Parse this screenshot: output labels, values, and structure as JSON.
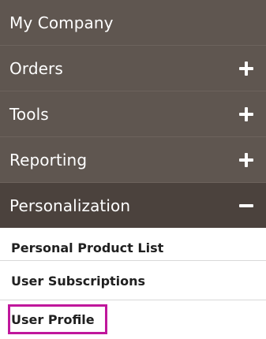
{
  "menu": {
    "title": "My Company",
    "items": [
      {
        "label": "Orders",
        "state": "collapsed",
        "icon": "plus-icon"
      },
      {
        "label": "Tools",
        "state": "collapsed",
        "icon": "plus-icon"
      },
      {
        "label": "Reporting",
        "state": "collapsed",
        "icon": "plus-icon"
      },
      {
        "label": "Personalization",
        "state": "expanded",
        "icon": "minus-icon",
        "subitems": [
          {
            "label": "Personal Product List"
          },
          {
            "label": "User Subscriptions"
          },
          {
            "label": "User Profile",
            "highlighted": true
          }
        ]
      }
    ]
  },
  "colors": {
    "menu_background": "#5f5650",
    "active_background": "#4b423d",
    "highlight_border": "#c0179c",
    "subitem_text": "#202020"
  }
}
